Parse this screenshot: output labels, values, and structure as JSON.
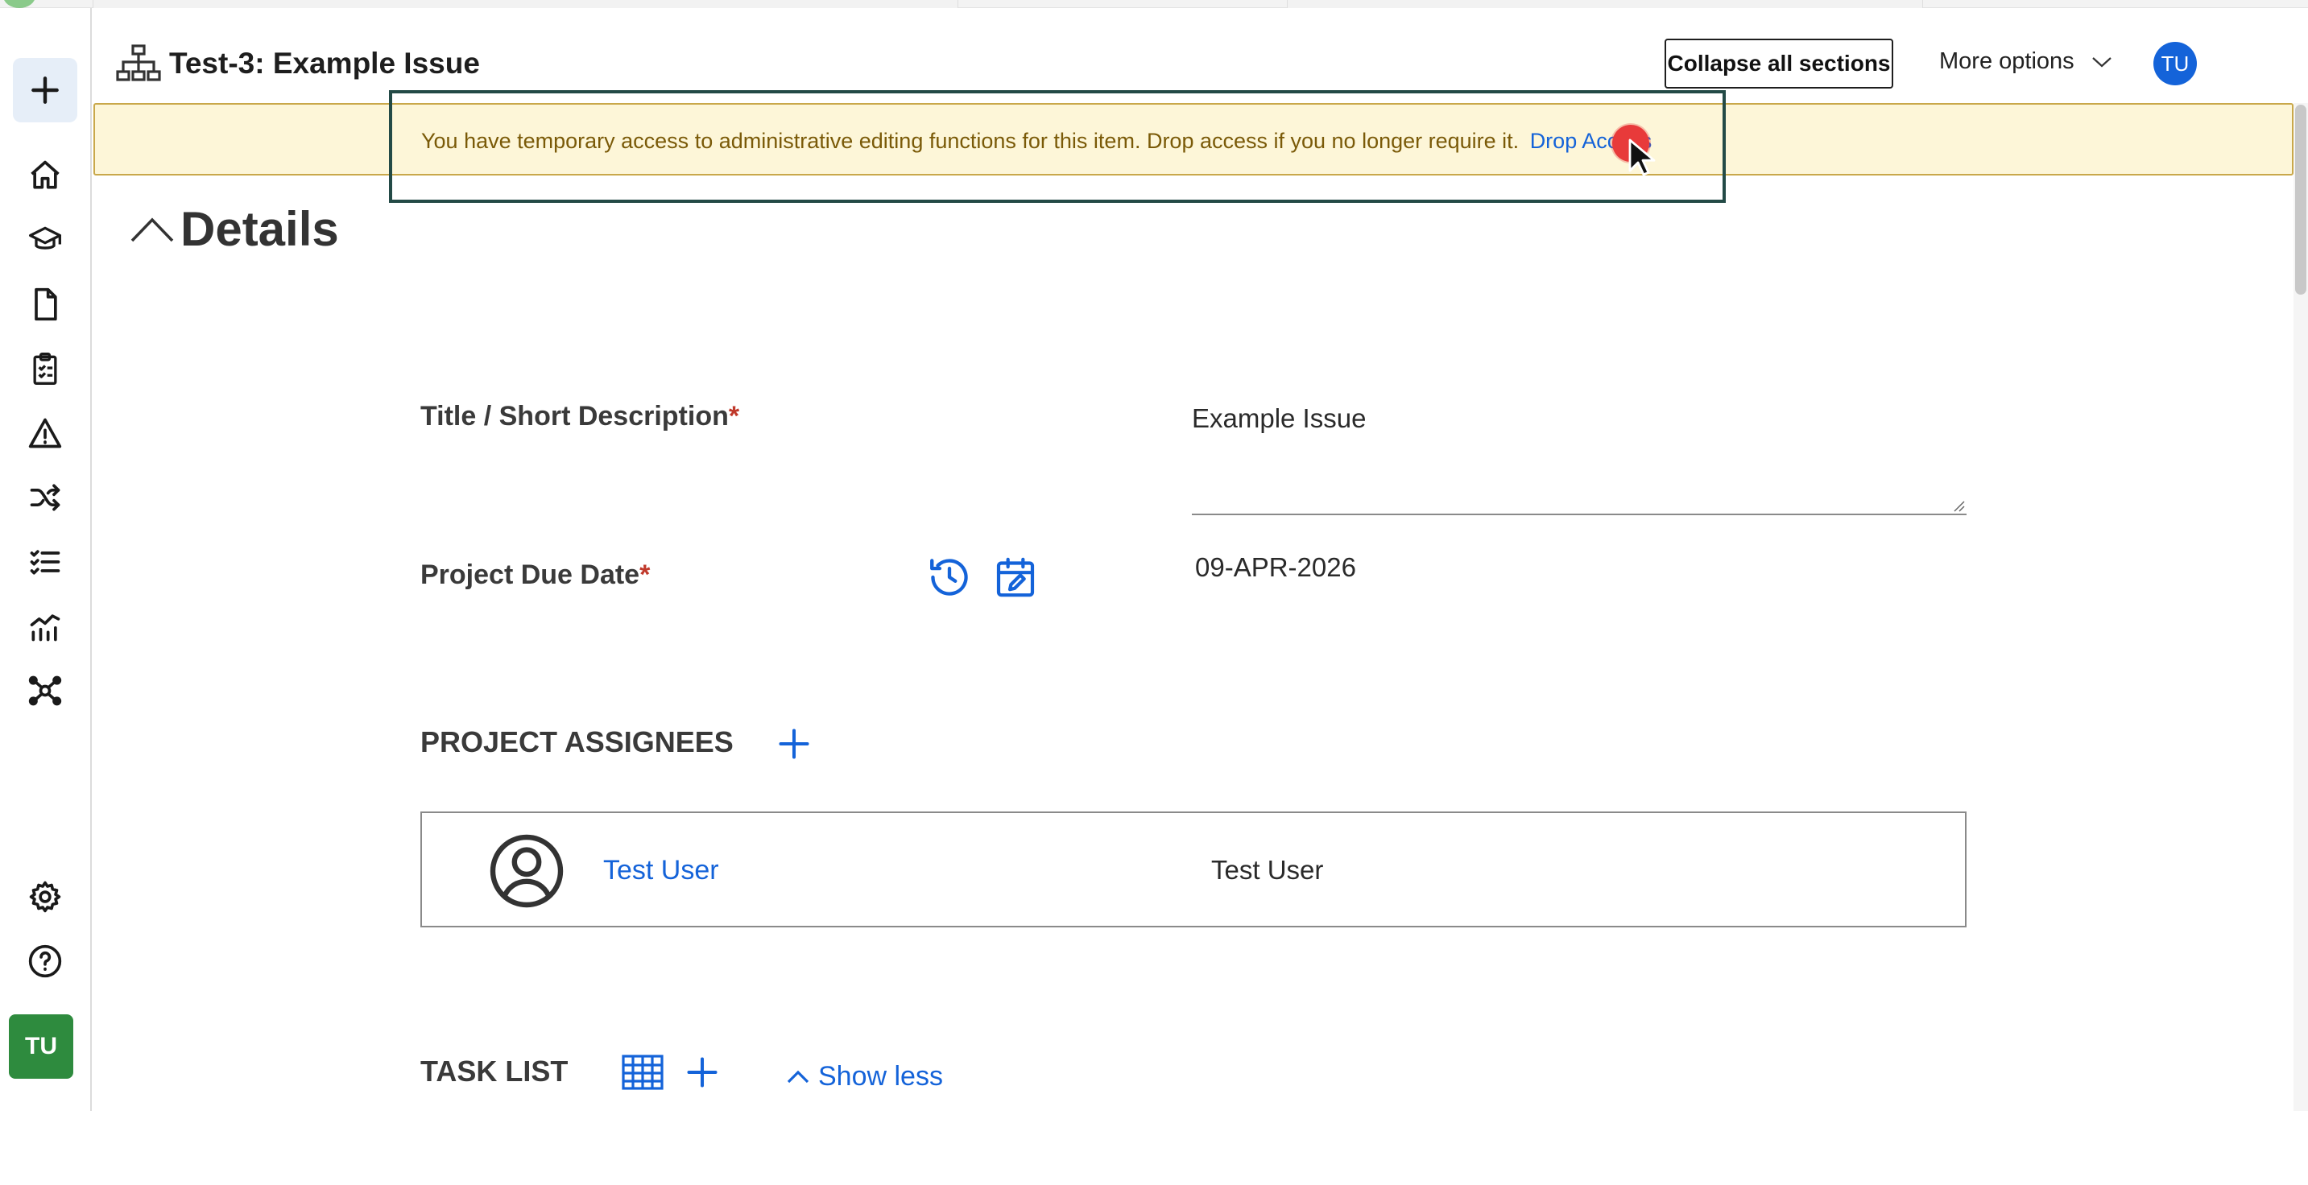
{
  "header": {
    "title": "Test-3: Example Issue",
    "collapse_label": "Collapse all sections",
    "more_options_label": "More options",
    "avatar_initials": "TU"
  },
  "banner": {
    "message": "You have temporary access to administrative editing functions for this item. Drop access if you no longer require it.",
    "link_label": "Drop Access"
  },
  "sidebar": {
    "avatar_initials": "TU",
    "icons": [
      "plus-icon",
      "home-icon",
      "graduation-cap-icon",
      "document-icon",
      "clipboard-checklist-icon",
      "warning-triangle-icon",
      "shuffle-icon",
      "checklist-icon",
      "chart-icon",
      "network-icon",
      "gear-icon",
      "help-icon"
    ]
  },
  "section": {
    "title": "Details"
  },
  "fields": {
    "title_label": "Title / Short Description",
    "title_value": "Example Issue",
    "due_date_label": "Project Due Date",
    "due_date_value": "09-APR-2026",
    "required_mark": "*"
  },
  "assignees": {
    "heading": "PROJECT ASSIGNEES",
    "rows": [
      {
        "link": "Test User",
        "name": "Test User"
      }
    ]
  },
  "tasks": {
    "heading": "TASK LIST",
    "show_less_label": "Show less"
  },
  "colors": {
    "accent": "#1463d9",
    "banner_bg": "#fdf6d8",
    "banner_text": "#7a5a08",
    "required": "#c0392b",
    "avatar_green": "#2e8b3e"
  }
}
